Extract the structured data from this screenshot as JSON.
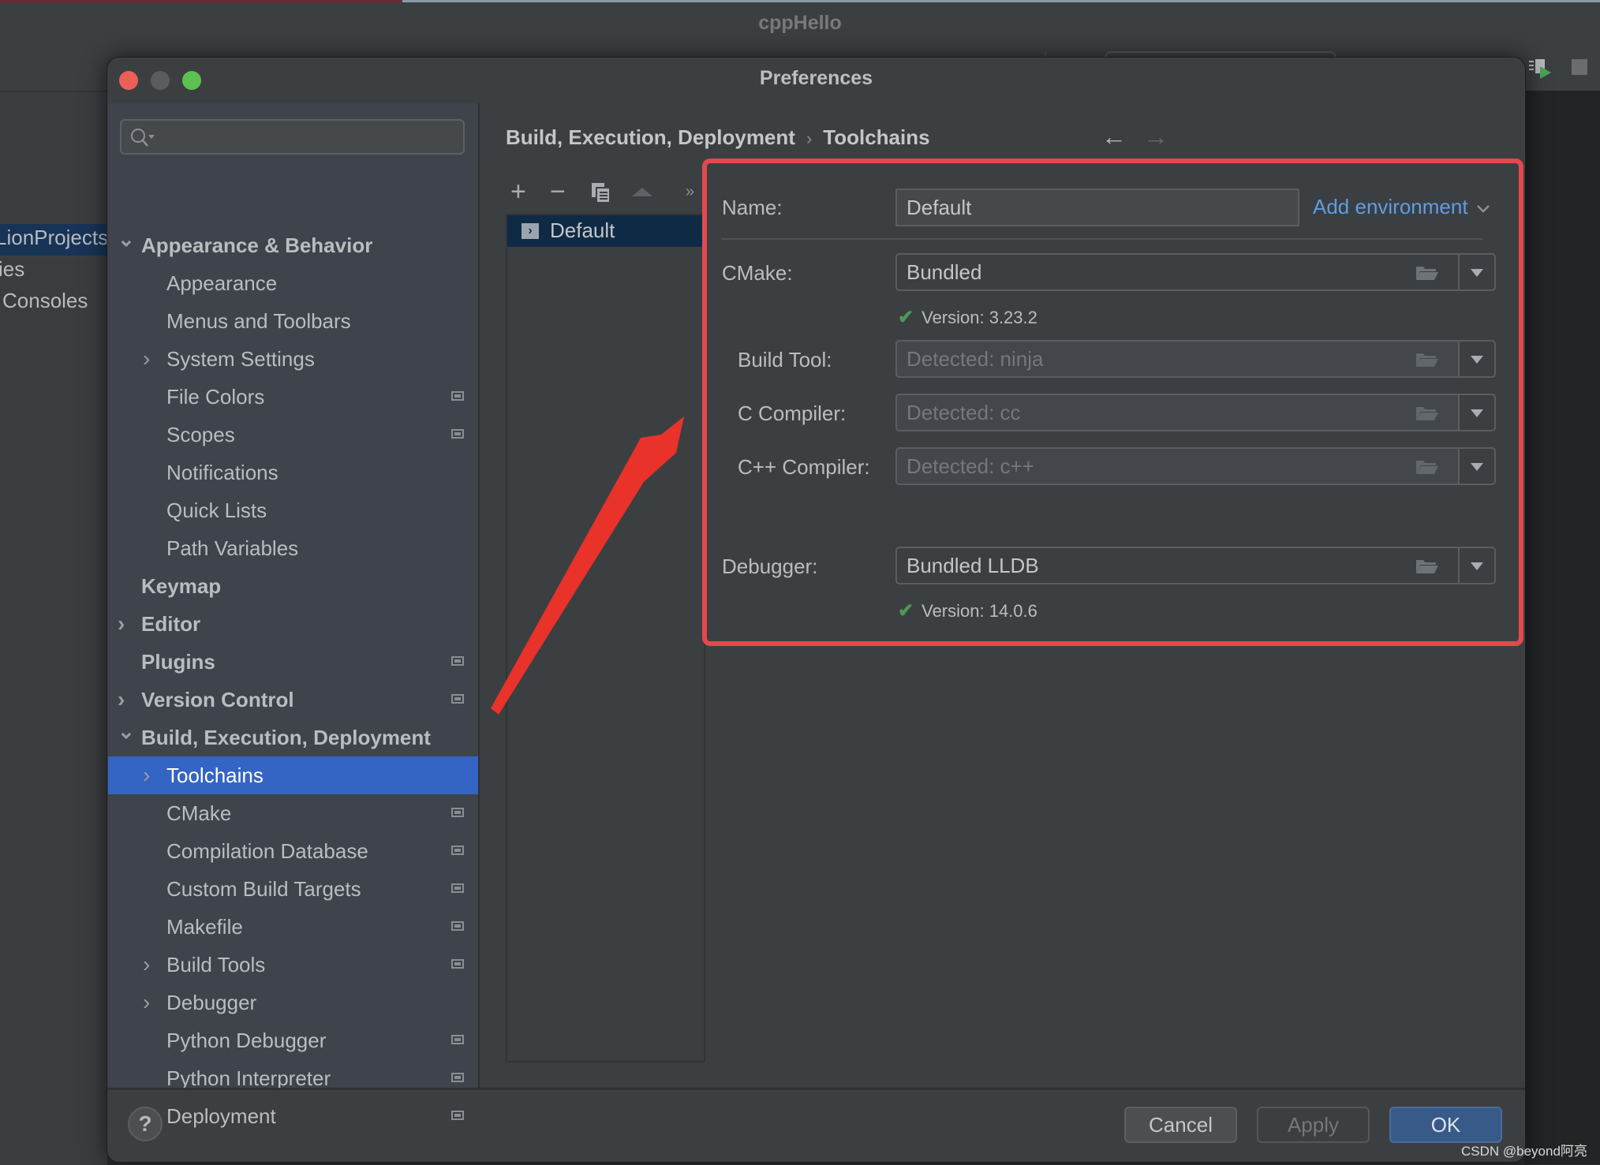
{
  "background_ide": {
    "window_title": "cppHello",
    "project_tree_fragments": [
      "LionProjects",
      "ies",
      "Consoles"
    ]
  },
  "dialog": {
    "title": "Preferences",
    "search": {
      "placeholder": "",
      "value": ""
    },
    "sidebar": {
      "items": [
        {
          "label": "Appearance & Behavior",
          "level": 0,
          "bold": true,
          "expander": "expanded",
          "project_icon": false
        },
        {
          "label": "Appearance",
          "level": 1,
          "bold": false,
          "expander": "none",
          "project_icon": false
        },
        {
          "label": "Menus and Toolbars",
          "level": 1,
          "bold": false,
          "expander": "none",
          "project_icon": false
        },
        {
          "label": "System Settings",
          "level": 1,
          "bold": false,
          "expander": "collapsed",
          "project_icon": false
        },
        {
          "label": "File Colors",
          "level": 1,
          "bold": false,
          "expander": "none",
          "project_icon": true
        },
        {
          "label": "Scopes",
          "level": 1,
          "bold": false,
          "expander": "none",
          "project_icon": true
        },
        {
          "label": "Notifications",
          "level": 1,
          "bold": false,
          "expander": "none",
          "project_icon": false
        },
        {
          "label": "Quick Lists",
          "level": 1,
          "bold": false,
          "expander": "none",
          "project_icon": false
        },
        {
          "label": "Path Variables",
          "level": 1,
          "bold": false,
          "expander": "none",
          "project_icon": false
        },
        {
          "label": "Keymap",
          "level": 0,
          "bold": true,
          "expander": "none",
          "project_icon": false
        },
        {
          "label": "Editor",
          "level": 0,
          "bold": true,
          "expander": "collapsed",
          "project_icon": false
        },
        {
          "label": "Plugins",
          "level": 0,
          "bold": true,
          "expander": "none",
          "project_icon": true
        },
        {
          "label": "Version Control",
          "level": 0,
          "bold": true,
          "expander": "collapsed",
          "project_icon": true
        },
        {
          "label": "Build, Execution, Deployment",
          "level": 0,
          "bold": true,
          "expander": "expanded",
          "project_icon": false
        },
        {
          "label": "Toolchains",
          "level": 1,
          "bold": false,
          "expander": "collapsed",
          "project_icon": false,
          "selected": true
        },
        {
          "label": "CMake",
          "level": 1,
          "bold": false,
          "expander": "none",
          "project_icon": true
        },
        {
          "label": "Compilation Database",
          "level": 1,
          "bold": false,
          "expander": "none",
          "project_icon": true
        },
        {
          "label": "Custom Build Targets",
          "level": 1,
          "bold": false,
          "expander": "none",
          "project_icon": true
        },
        {
          "label": "Makefile",
          "level": 1,
          "bold": false,
          "expander": "none",
          "project_icon": true
        },
        {
          "label": "Build Tools",
          "level": 1,
          "bold": false,
          "expander": "collapsed",
          "project_icon": true
        },
        {
          "label": "Debugger",
          "level": 1,
          "bold": false,
          "expander": "collapsed",
          "project_icon": false
        },
        {
          "label": "Python Debugger",
          "level": 1,
          "bold": false,
          "expander": "none",
          "project_icon": true
        },
        {
          "label": "Python Interpreter",
          "level": 1,
          "bold": false,
          "expander": "none",
          "project_icon": true
        },
        {
          "label": "Deployment",
          "level": 1,
          "bold": false,
          "expander": "collapsed",
          "project_icon": true
        }
      ]
    },
    "breadcrumb": {
      "parent": "Build, Execution, Deployment",
      "separator": "›",
      "current": "Toolchains"
    },
    "nav": {
      "back": "←",
      "forward": "→"
    },
    "toolchain_list": {
      "toolbar": {
        "add": "+",
        "remove": "−",
        "copy": "copy-icon",
        "move_up": "▲",
        "more": "»"
      },
      "items": [
        {
          "label": "Default",
          "selected": true
        }
      ]
    },
    "form": {
      "name": {
        "label": "Name:",
        "value": "Default"
      },
      "add_environment": "Add environment",
      "cmake": {
        "label": "CMake:",
        "value": "Bundled",
        "version": "Version: 3.23.2"
      },
      "build_tool": {
        "label": "Build Tool:",
        "placeholder": "Detected: ninja"
      },
      "c_compiler": {
        "label": "C Compiler:",
        "placeholder": "Detected: cc"
      },
      "cpp_compiler": {
        "label": "C++ Compiler:",
        "placeholder": "Detected: c++"
      },
      "debugger": {
        "label": "Debugger:",
        "value": "Bundled LLDB",
        "version": "Version: 14.0.6"
      }
    },
    "footer": {
      "help": "?",
      "cancel": "Cancel",
      "apply": "Apply",
      "ok": "OK"
    }
  },
  "annotation": {
    "highlight_color": "#e5484d",
    "arrow_color": "#e8322a"
  },
  "watermark": "CSDN @beyond阿亮"
}
